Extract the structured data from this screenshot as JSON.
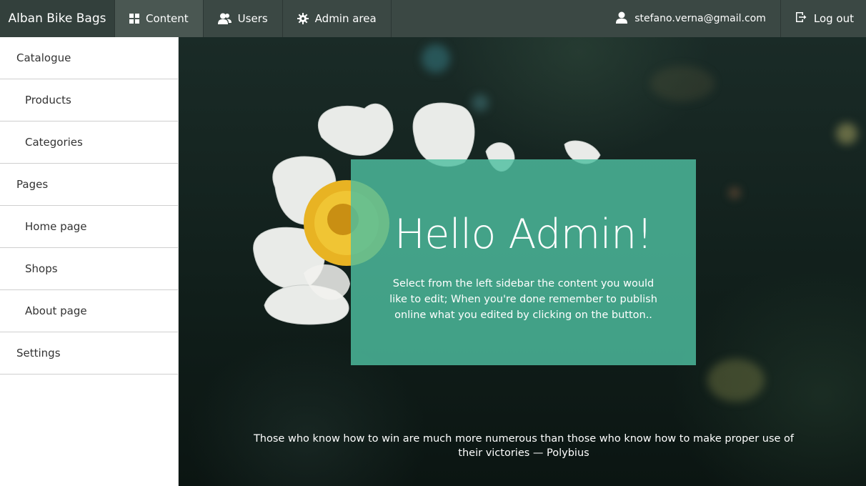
{
  "brand": "Alban Bike Bags",
  "nav": {
    "content_label": "Content",
    "users_label": "Users",
    "admin_label": "Admin area",
    "user_email": "stefano.verna@gmail.com",
    "logout_label": "Log out"
  },
  "sidebar": {
    "items": [
      {
        "label": "Catalogue"
      },
      {
        "label": "Products"
      },
      {
        "label": "Categories"
      },
      {
        "label": "Pages"
      },
      {
        "label": "Home page"
      },
      {
        "label": "Shops"
      },
      {
        "label": "About page"
      },
      {
        "label": "Settings"
      }
    ]
  },
  "hero": {
    "title": "Hello Admin!",
    "text": "Select from the left sidebar the content you would like to edit; When you're done remember to publish online what you edited by clicking on the button..",
    "quote": "Those who know how to win are much more numerous than those who know how to make proper use of their victories — Polybius"
  },
  "colors": {
    "topbar": "#3b4844",
    "card": "#4ebea0"
  }
}
